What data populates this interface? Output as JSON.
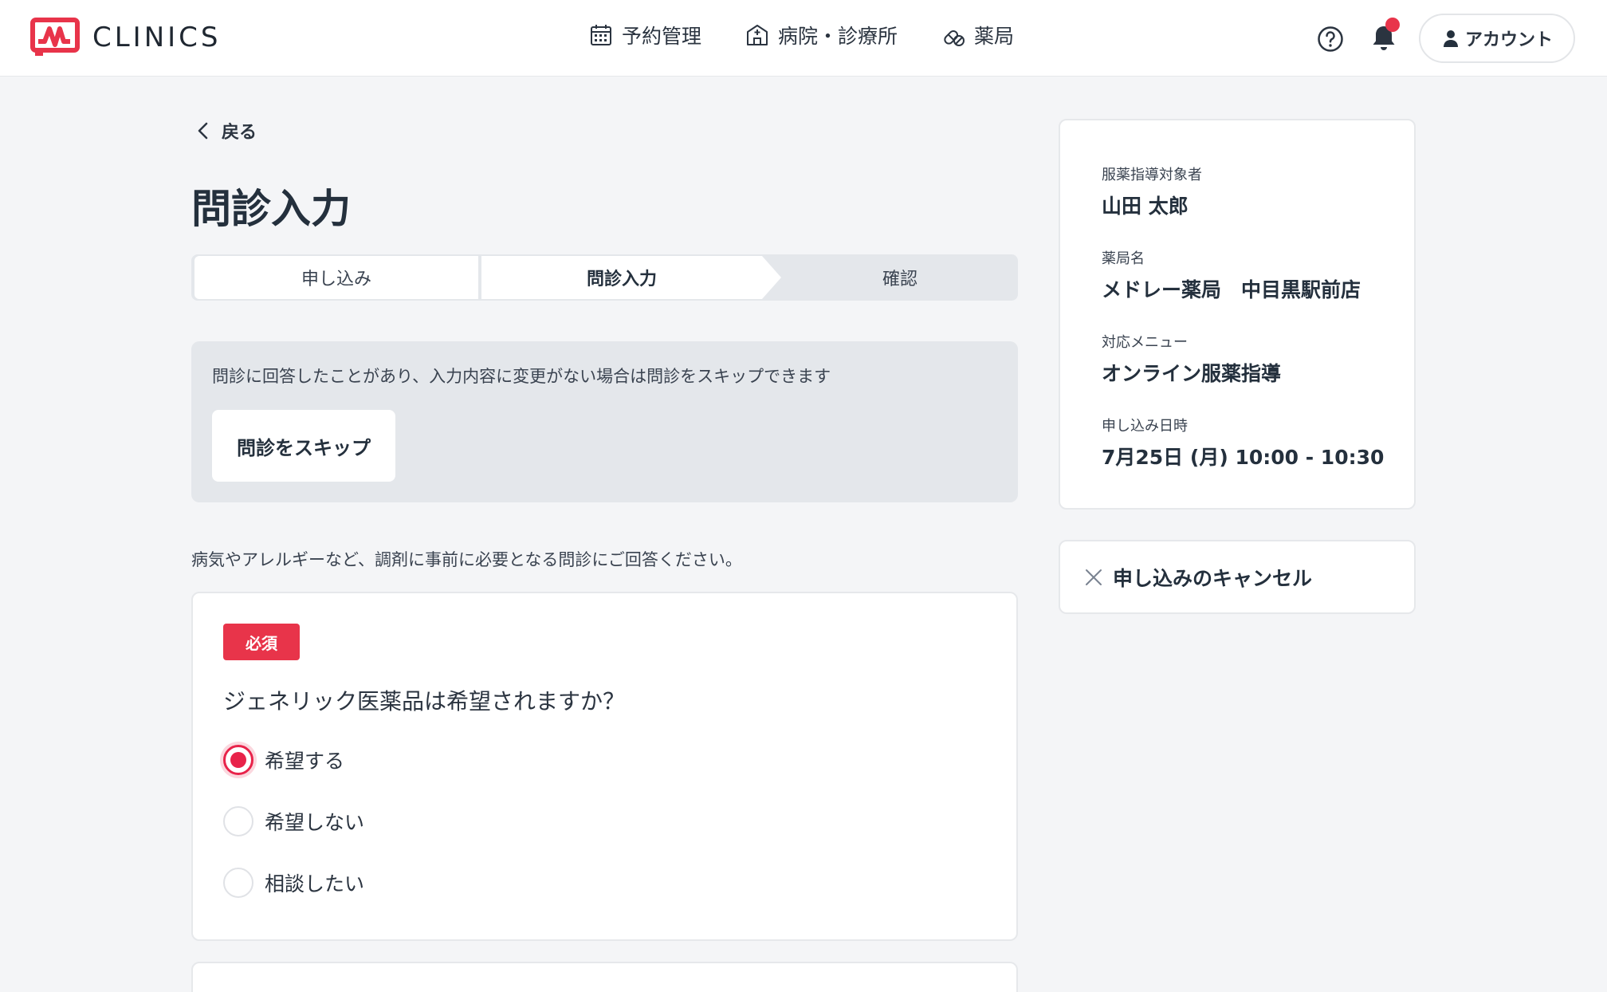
{
  "header": {
    "brand": "CLINICS",
    "nav": [
      {
        "label": "予約管理",
        "icon": "calendar-icon"
      },
      {
        "label": "病院・診療所",
        "icon": "hospital-icon"
      },
      {
        "label": "薬局",
        "icon": "pill-icon"
      }
    ],
    "account_label": "アカウント"
  },
  "back_label": "戻る",
  "page_title": "問診入力",
  "stepper": [
    "申し込み",
    "問診入力",
    "確認"
  ],
  "skip": {
    "message": "問診に回答したことがあり、入力内容に変更がない場合は問診をスキップできます",
    "button_label": "問診をスキップ"
  },
  "intro": "病気やアレルギーなど、調剤に事前に必要となる問診にご回答ください。",
  "question": {
    "required_badge": "必須",
    "text": "ジェネリック医薬品は希望されますか？",
    "options": [
      "希望する",
      "希望しない",
      "相談したい"
    ],
    "selected": "希望する"
  },
  "sidebar": {
    "rows": [
      {
        "label": "服薬指導対象者",
        "value": "山田 太郎"
      },
      {
        "label": "薬局名",
        "value": "メドレー薬局　中目黒駅前店"
      },
      {
        "label": "対応メニュー",
        "value": "オンライン服薬指導"
      },
      {
        "label": "申し込み日時",
        "value": "7月25日 (月) 10:00 - 10:30"
      }
    ],
    "cancel_label": "申し込みのキャンセル"
  },
  "colors": {
    "accent": "#e8344a",
    "background": "#f4f5f7",
    "panel": "#e4e7eb"
  }
}
